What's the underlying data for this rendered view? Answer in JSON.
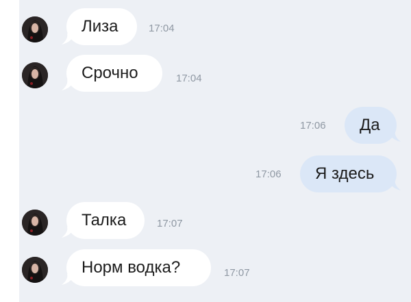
{
  "messages": [
    {
      "direction": "incoming",
      "text": "Лиза",
      "time": "17:04"
    },
    {
      "direction": "incoming",
      "text": "Срочно",
      "time": "17:04"
    },
    {
      "direction": "outgoing",
      "text": "Да",
      "time": "17:06"
    },
    {
      "direction": "outgoing",
      "text": "Я здесь",
      "time": "17:06"
    },
    {
      "direction": "incoming",
      "text": "Талка",
      "time": "17:07"
    },
    {
      "direction": "incoming",
      "text": "Норм водка?",
      "time": "17:07"
    }
  ],
  "colors": {
    "background": "#edf0f5",
    "incoming_bubble": "#ffffff",
    "outgoing_bubble": "#dbe7f7",
    "timestamp": "#8f98a3"
  },
  "icons": {
    "avatar": "avatar-photo"
  }
}
